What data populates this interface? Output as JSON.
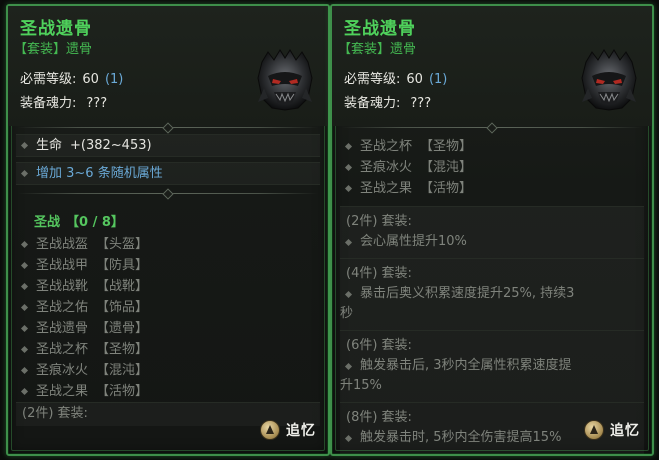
{
  "left": {
    "title": "圣战遗骨",
    "subtitle": "【套装】遗骨",
    "req_label": "必需等级:",
    "req_value": "60",
    "req_extra": "(1)",
    "soul_label": "装备魂力:",
    "soul_value": "???",
    "stats": [
      {
        "label": "生命",
        "value": "+(382~453)"
      }
    ],
    "random_attr": "增加 3~6 条随机属性",
    "set_name": "圣战",
    "set_count": "【0 / 8】",
    "set_items": [
      {
        "name": "圣战战盔",
        "slot": "【头盔】"
      },
      {
        "name": "圣战战甲",
        "slot": "【防具】"
      },
      {
        "name": "圣战战靴",
        "slot": "【战靴】"
      },
      {
        "name": "圣战之佑",
        "slot": "【饰品】"
      },
      {
        "name": "圣战遗骨",
        "slot": "【遗骨】"
      },
      {
        "name": "圣战之杯",
        "slot": "【圣物】"
      },
      {
        "name": "圣痕冰火",
        "slot": "【混沌】"
      },
      {
        "name": "圣战之果",
        "slot": "【活物】"
      }
    ],
    "bonus_preview": "(2件) 套装:",
    "recall_label": "追忆"
  },
  "right": {
    "title": "圣战遗骨",
    "subtitle": "【套装】遗骨",
    "req_label": "必需等级:",
    "req_value": "60",
    "req_extra": "(1)",
    "soul_label": "装备魂力:",
    "soul_value": "???",
    "set_items": [
      {
        "name": "圣战之杯",
        "slot": "【圣物】"
      },
      {
        "name": "圣痕冰火",
        "slot": "【混沌】"
      },
      {
        "name": "圣战之果",
        "slot": "【活物】"
      }
    ],
    "bonuses": [
      {
        "head": "(2件) 套装:",
        "effect": "会心属性提升10%",
        "cont": ""
      },
      {
        "head": "(4件) 套装:",
        "effect": "暴击后奥义积累速度提升25%, 持续3",
        "cont": "秒"
      },
      {
        "head": "(6件) 套装:",
        "effect": "触发暴击后, 3秒内全属性积累速度提",
        "cont": "升15%"
      },
      {
        "head": "(8件) 套装:",
        "effect": "触发暴击时, 5秒内全伤害提高15%",
        "cont": ""
      }
    ],
    "recall_label": "追忆"
  },
  "colors": {
    "frame_green": "#3e8f4a",
    "title_green": "#4fd25c",
    "blue_value": "#6aa9d6",
    "dim_text": "#7f837c"
  },
  "icons": {
    "helm": "demon-helm-icon",
    "recall": "recall-icon"
  }
}
